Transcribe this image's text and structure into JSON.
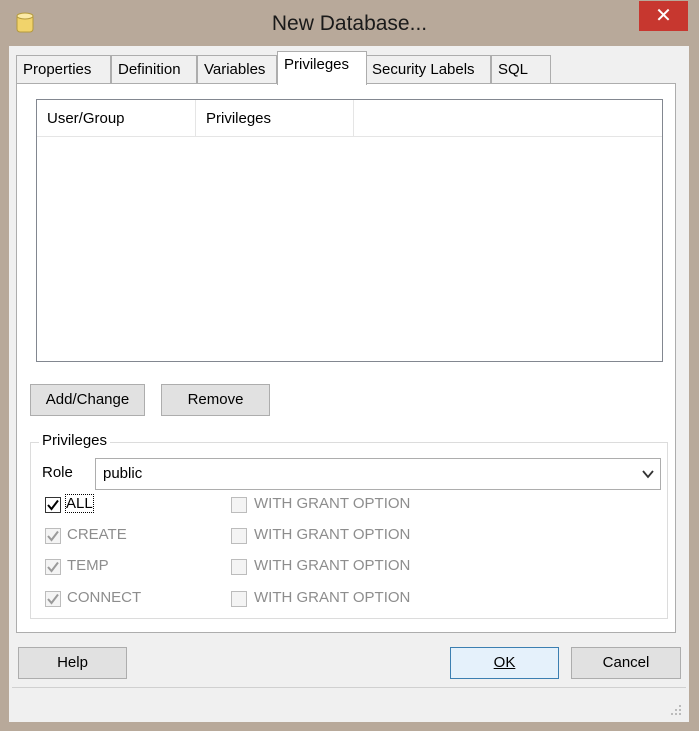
{
  "window": {
    "title": "New Database...",
    "close_symbol": "✕"
  },
  "tabs": [
    {
      "label": "Properties",
      "active": false
    },
    {
      "label": "Definition",
      "active": false
    },
    {
      "label": "Variables",
      "active": false
    },
    {
      "label": "Privileges",
      "active": true
    },
    {
      "label": "Security Labels",
      "active": false
    },
    {
      "label": "SQL",
      "active": false
    }
  ],
  "privileges_list": {
    "columns": [
      "User/Group",
      "Privileges"
    ],
    "rows": []
  },
  "buttons": {
    "add_change": "Add/Change",
    "remove": "Remove"
  },
  "privileges_group": {
    "title": "Privileges",
    "role_label": "Role",
    "role_value": "public",
    "items": [
      {
        "label": "ALL",
        "checked": true,
        "enabled": true,
        "grant_label": "WITH GRANT OPTION",
        "grant_checked": false,
        "grant_enabled": false
      },
      {
        "label": "CREATE",
        "checked": true,
        "enabled": false,
        "grant_label": "WITH GRANT OPTION",
        "grant_checked": false,
        "grant_enabled": false
      },
      {
        "label": "TEMP",
        "checked": true,
        "enabled": false,
        "grant_label": "WITH GRANT OPTION",
        "grant_checked": false,
        "grant_enabled": false
      },
      {
        "label": "CONNECT",
        "checked": true,
        "enabled": false,
        "grant_label": "WITH GRANT OPTION",
        "grant_checked": false,
        "grant_enabled": false
      }
    ]
  },
  "footer": {
    "help": "Help",
    "ok": "OK",
    "cancel": "Cancel"
  },
  "colors": {
    "frame": "#b8a99a",
    "close": "#c7372f",
    "default_button_border": "#3c7fb1"
  },
  "icons": {
    "app": "database-icon",
    "close": "close-icon",
    "combo": "chevron-down-icon",
    "grip": "resize-grip-icon"
  }
}
